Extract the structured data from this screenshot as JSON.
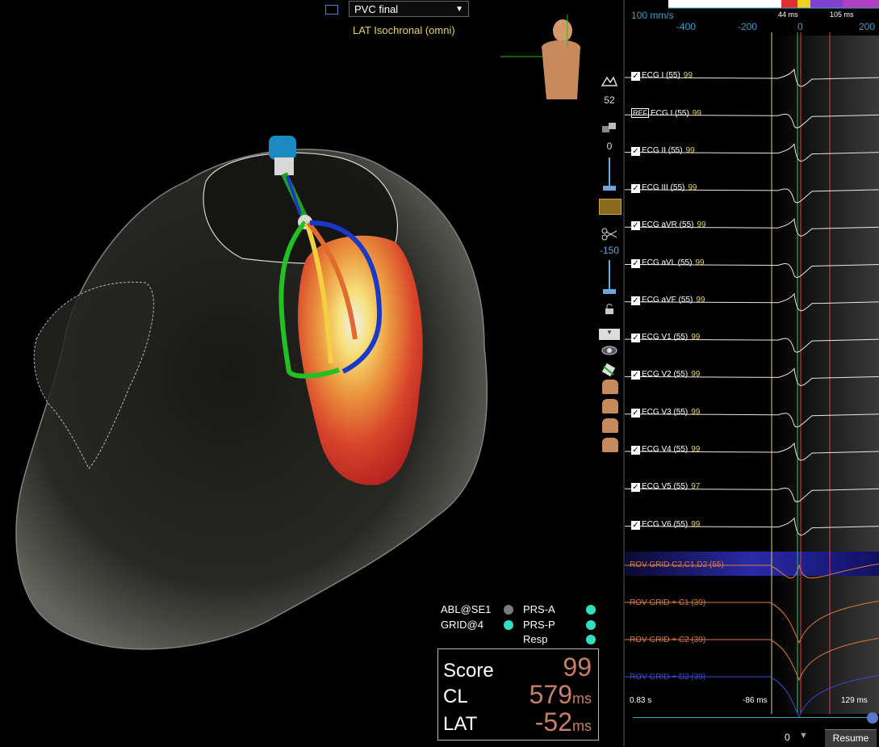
{
  "map": {
    "view_dropdown": "PVC final",
    "subtitle": "LAT Isochronal (omni)"
  },
  "toolbar": {
    "transparency_value": "52",
    "upper_value": "0",
    "lower_value": "-150"
  },
  "legend": {
    "left": [
      {
        "label": "ABL@SE1",
        "color": "#7a7a7a"
      },
      {
        "label": "GRID@4",
        "color": "#30e0c0"
      }
    ],
    "right": [
      {
        "label": "PRS-A",
        "color": "#30e0c0"
      },
      {
        "label": "PRS-P",
        "color": "#30e0c0"
      },
      {
        "label": "Resp",
        "color": "#30e0c0"
      }
    ]
  },
  "score": {
    "score_label": "Score",
    "score_value": "99",
    "cl_label": "CL",
    "cl_value": "579",
    "cl_unit": "ms",
    "lat_label": "LAT",
    "lat_value": "-52",
    "lat_unit": "ms"
  },
  "ecg": {
    "speed": "100 mm/s",
    "axis_ticks": [
      "-400",
      "-200",
      "0",
      "200"
    ],
    "window_left": "44 ms",
    "window_right": "105 ms",
    "channels": [
      {
        "name": "ECG I (55)",
        "val": "99",
        "check": true,
        "ref": false
      },
      {
        "name": "ECG I (55)",
        "val": "99",
        "check": false,
        "ref": true
      },
      {
        "name": "ECG II (55)",
        "val": "99",
        "check": true,
        "ref": false
      },
      {
        "name": "ECG III (55)",
        "val": "99",
        "check": true,
        "ref": false
      },
      {
        "name": "ECG aVR (55)",
        "val": "99",
        "check": true,
        "ref": false
      },
      {
        "name": "ECG aVL (55)",
        "val": "99",
        "check": true,
        "ref": false
      },
      {
        "name": "ECG aVF (55)",
        "val": "99",
        "check": true,
        "ref": false
      },
      {
        "name": "ECG V1 (55)",
        "val": "99",
        "check": true,
        "ref": false
      },
      {
        "name": "ECG V2 (55)",
        "val": "99",
        "check": true,
        "ref": false
      },
      {
        "name": "ECG V3 (55)",
        "val": "99",
        "check": true,
        "ref": false
      },
      {
        "name": "ECG V4 (55)",
        "val": "99",
        "check": true,
        "ref": false
      },
      {
        "name": "ECG V5 (55)",
        "val": "97",
        "check": true,
        "ref": false
      },
      {
        "name": "ECG V6 (55)",
        "val": "99",
        "check": true,
        "ref": false
      }
    ],
    "rov": [
      {
        "name": "ROV GRID  C2,C1,D2 (55)",
        "color": "#e07a3a"
      },
      {
        "name": "ROV GRID + C1 (39)",
        "color": "#e07a3a"
      },
      {
        "name": "ROV GRID + C2 (39)",
        "color": "#e07a3a"
      },
      {
        "name": "ROV GRID + D2 (39)",
        "color": "#3a4ad8"
      }
    ],
    "time_start": "0.83 s",
    "time_mid": "-86 ms",
    "time_end": "129 ms",
    "page_value": "0",
    "resume_label": "Resume"
  }
}
